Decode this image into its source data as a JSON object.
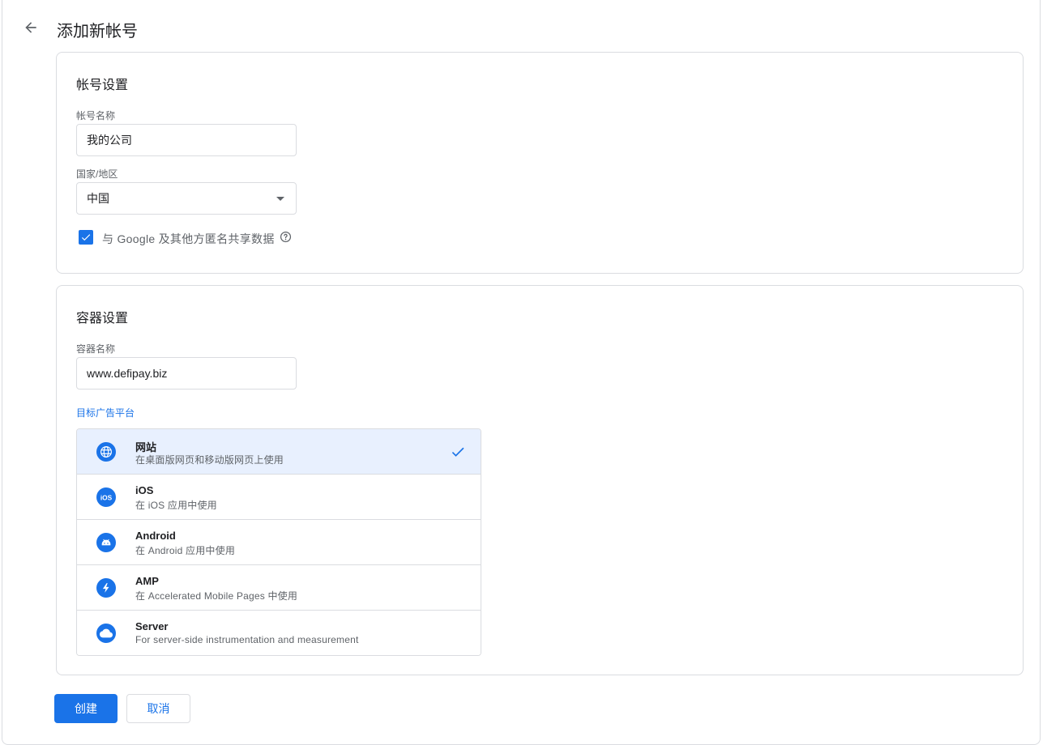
{
  "header": {
    "title": "添加新帐号"
  },
  "account": {
    "section_title": "帐号设置",
    "name_label": "帐号名称",
    "name_value": "我的公司",
    "country_label": "国家/地区",
    "country_value": "中国",
    "share_label": "与 Google 及其他方匿名共享数据",
    "share_checked": true
  },
  "container": {
    "section_title": "容器设置",
    "name_label": "容器名称",
    "name_value": "www.defipay.biz",
    "platform_label": "目标广告平台",
    "platforms": [
      {
        "name": "网站",
        "desc": "在桌面版网页和移动版网页上使用",
        "icon": "globe-icon",
        "selected": true
      },
      {
        "name": "iOS",
        "desc": "在 iOS 应用中使用",
        "icon": "ios-icon",
        "selected": false
      },
      {
        "name": "Android",
        "desc": "在 Android 应用中使用",
        "icon": "android-icon",
        "selected": false
      },
      {
        "name": "AMP",
        "desc": "在 Accelerated Mobile Pages 中使用",
        "icon": "lightning-icon",
        "selected": false
      },
      {
        "name": "Server",
        "desc": "For server-side instrumentation and measurement",
        "icon": "cloud-icon",
        "selected": false
      }
    ]
  },
  "actions": {
    "create_label": "创建",
    "cancel_label": "取消"
  },
  "colors": {
    "accent": "#1a73e8",
    "selected_bg": "#e8f0fe",
    "border": "#dadce0"
  }
}
